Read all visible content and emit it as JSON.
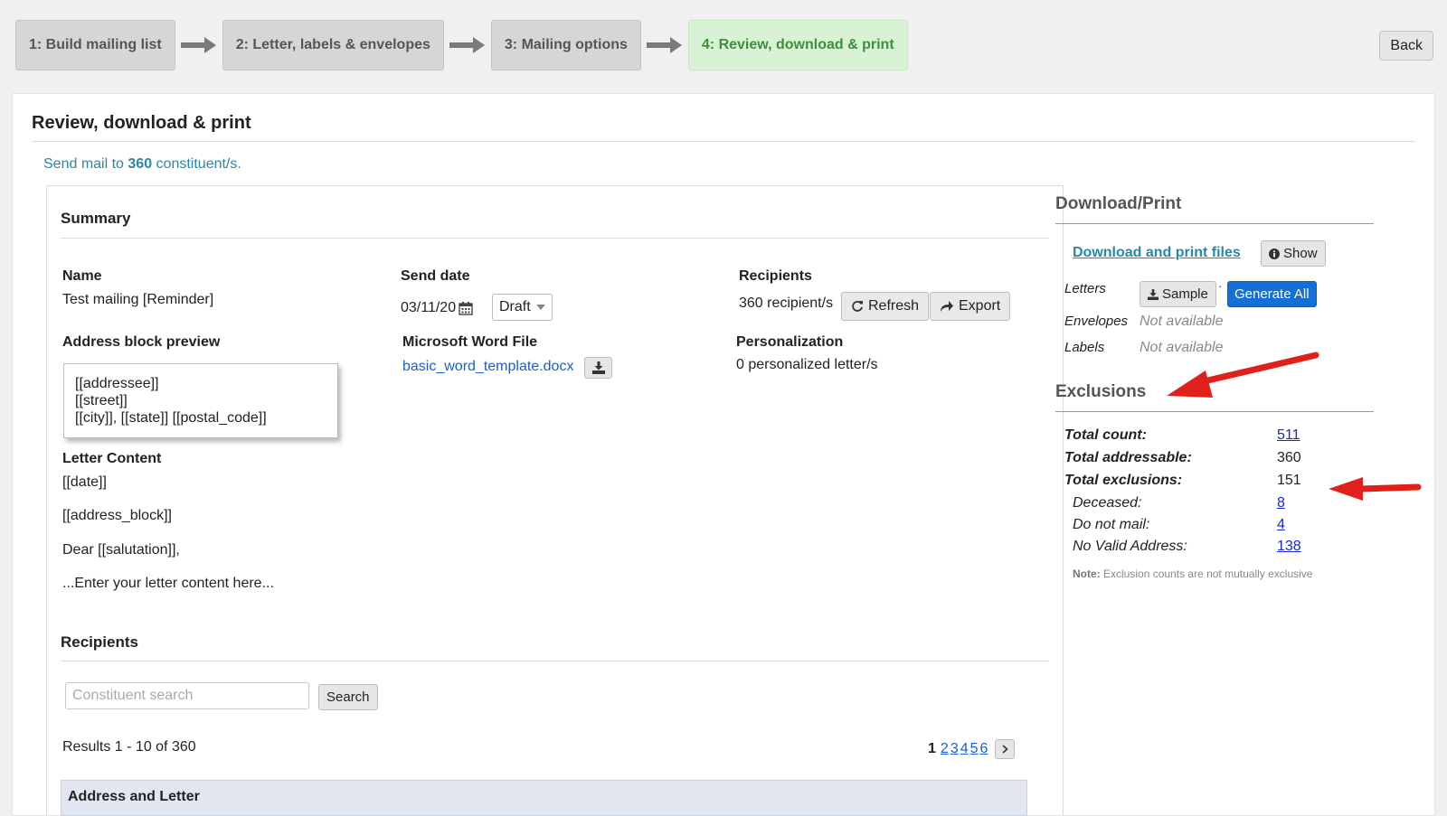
{
  "steps": [
    {
      "label": "1: Build mailing list"
    },
    {
      "label": "2: Letter, labels & envelopes"
    },
    {
      "label": "3: Mailing options"
    },
    {
      "label": "4: Review, download & print"
    }
  ],
  "back_label": "Back",
  "page_title": "Review, download & print",
  "send": {
    "prefix": "Send mail to",
    "count": "360",
    "suffix": "constituent/s."
  },
  "summary": {
    "title": "Summary",
    "name_label": "Name",
    "name_value": "Test mailing [Reminder]",
    "send_date_label": "Send date",
    "send_date_value": "03/11/20",
    "status_select": "Draft",
    "recipients_label": "Recipients",
    "recipients_value": "360 recipient/s",
    "refresh_label": "Refresh",
    "export_label": "Export",
    "address_preview_label": "Address block preview",
    "address_lines": [
      "[[addressee]]",
      "[[street]]",
      "[[city]], [[state]] [[postal_code]]"
    ],
    "word_file_label": "Microsoft Word File",
    "word_file_link": "basic_word_template.docx",
    "personalization_label": "Personalization",
    "personalization_value": "0 personalized letter/s",
    "letter_content_label": "Letter Content",
    "letter_lines": [
      "[[date]]",
      "[[address_block]]",
      "Dear [[salutation]],",
      "...Enter your letter content here..."
    ]
  },
  "recipients": {
    "title": "Recipients",
    "search_placeholder": "Constituent search",
    "search_button": "Search",
    "results_text": "Results 1 - 10 of 360",
    "pages": [
      "1",
      "2",
      "3",
      "4",
      "5",
      "6"
    ],
    "current_page": "1",
    "table_header": "Address and Letter"
  },
  "download": {
    "title": "Download/Print",
    "files_link": "Download and print files",
    "show_label": "Show",
    "letters_label": "Letters",
    "sample_label": "Sample",
    "separator": "·",
    "generate_label": "Generate All",
    "envelopes_label": "Envelopes",
    "envelopes_value": "Not available",
    "labels_label": "Labels",
    "labels_value": "Not available"
  },
  "exclusions": {
    "title": "Exclusions",
    "total_count_label": "Total count:",
    "total_count": "511",
    "total_addressable_label": "Total addressable:",
    "total_addressable": "360",
    "total_exclusions_label": "Total exclusions:",
    "total_exclusions": "151",
    "deceased_label": "Deceased:",
    "deceased": "8",
    "do_not_mail_label": "Do not mail:",
    "do_not_mail": "4",
    "no_valid_address_label": "No Valid Address:",
    "no_valid_address": "138",
    "note_label": "Note:",
    "note_text": "Exclusion counts are not mutually exclusive"
  },
  "colors": {
    "active_step_bg": "#d9f2d6",
    "active_step_text": "#3d8f3a",
    "link_blue": "#1a5fc9",
    "primary_button": "#1470d6",
    "annotation_arrow": "#e0211b"
  },
  "icons": [
    "arrow-right-icon",
    "calendar-icon",
    "caret-down-icon",
    "refresh-icon",
    "share-icon",
    "download-icon",
    "info-icon",
    "chevron-right-icon"
  ]
}
